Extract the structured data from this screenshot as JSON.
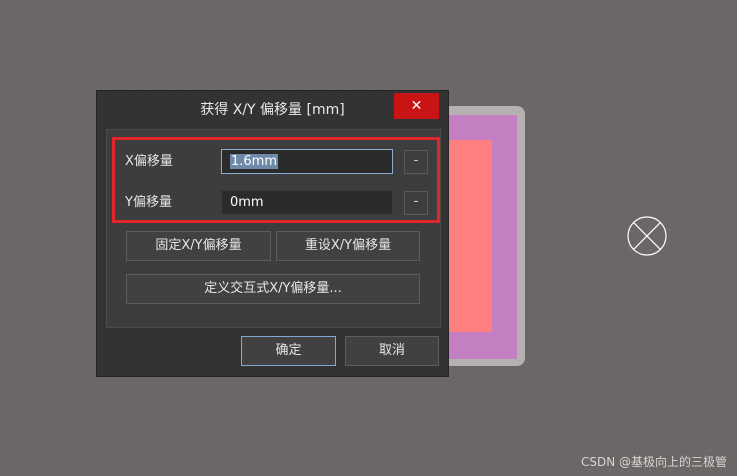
{
  "dialog": {
    "title": "获得 X/Y 偏移量 [mm]",
    "close_glyph": "✕",
    "x_offset_label": "X偏移量",
    "x_offset_value": "1.6mm",
    "y_offset_label": "Y偏移量",
    "y_offset_value": "0mm",
    "dash_label": "-",
    "fix_button": "固定X/Y偏移量",
    "reset_button": "重设X/Y偏移量",
    "define_button": "定义交互式X/Y偏移量...",
    "ok_button": "确定",
    "cancel_button": "取消"
  },
  "watermark": "CSDN @基极向上的三极管",
  "colors": {
    "highlight": "#e0262b",
    "close_button": "#c81414",
    "pcb_inner": "#ff7f7f",
    "pcb_mid": "#c27fc2",
    "pcb_outer": "#b5b1b0",
    "canvas": "#6b6766"
  },
  "icons": {
    "origin_marker": "crossed-circle-icon",
    "close": "close-icon"
  }
}
